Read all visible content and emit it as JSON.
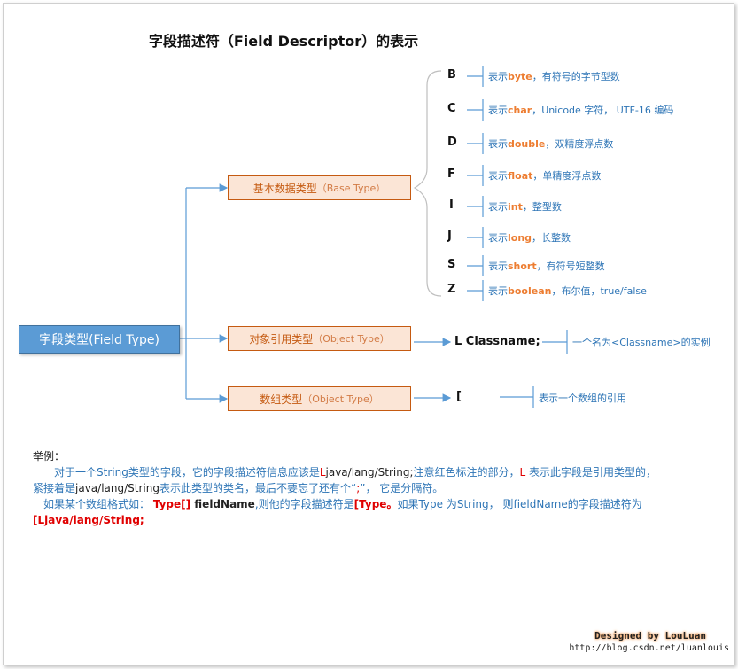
{
  "title": "字段描述符（Field Descriptor）的表示",
  "root": "字段类型(Field Type)",
  "base": {
    "label": "基本数据类型",
    "sub": "（Base Type）"
  },
  "object": {
    "label": "对象引用类型",
    "sub": "（Object Type）",
    "code": "L Classname;",
    "desc": "一个名为<Classname>的实例"
  },
  "array": {
    "label": "数组类型",
    "sub": "（Object Type）",
    "code": "[",
    "desc": "表示一个数组的引用"
  },
  "base_types": [
    {
      "code": "B",
      "prefix": "表示",
      "kw": "byte",
      "rest": "，有符号的字节型数"
    },
    {
      "code": "C",
      "prefix": "表示",
      "kw": "char",
      "rest": "，Unicode 字符， UTF-16 编码"
    },
    {
      "code": "D",
      "prefix": "表示",
      "kw": "double",
      "rest": "，双精度浮点数"
    },
    {
      "code": "F",
      "prefix": "表示",
      "kw": "float",
      "rest": "，单精度浮点数"
    },
    {
      "code": "I",
      "prefix": "表示",
      "kw": "int",
      "rest": "，整型数"
    },
    {
      "code": "J",
      "prefix": "表示",
      "kw": "long",
      "rest": "，长整数"
    },
    {
      "code": "S",
      "prefix": "表示",
      "kw": "short",
      "rest": "，有符号短整数"
    },
    {
      "code": "Z",
      "prefix": "表示",
      "kw": "boolean",
      "rest": "，布尔值，true/false"
    }
  ],
  "example": {
    "heading": "举例：",
    "l1a": "对于一个String类型的字段，它的字段描述符信息应该是",
    "l1b": "L",
    "l1c": "java/lang/String;",
    "l1d": "注意红色标注的部分，",
    "l1e": "L",
    "l1f": " 表示此字段是引用类型的，",
    "l2a": "紧接着是",
    "l2b": "java/lang/String",
    "l2c": "表示此类型的类名，最后不要忘了还有个“",
    "l2d": ";",
    "l2e": "”， 它是分隔符。",
    "l3a": "如果某个数组格式如：  ",
    "l3b": "Type[]",
    "l3c": "  fieldName",
    "l3d": ",则他的字段描述符是",
    "l3e": "[Type。",
    "l3f": "如果Type 为String， 则fieldName的字段描述符为",
    "l4": "[Ljava/lang/String;"
  },
  "signature": {
    "designer": "Designed by LouLuan",
    "url": "http://blog.csdn.net/luanlouis"
  },
  "colors": {
    "root": "#5b9bd5",
    "box_fill": "#fbe5d6",
    "box_border": "#c55a11",
    "connector": "#5b9bd5",
    "text_blue": "#2e75b6",
    "keyword": "#ed7d31",
    "red": "#e00000"
  }
}
